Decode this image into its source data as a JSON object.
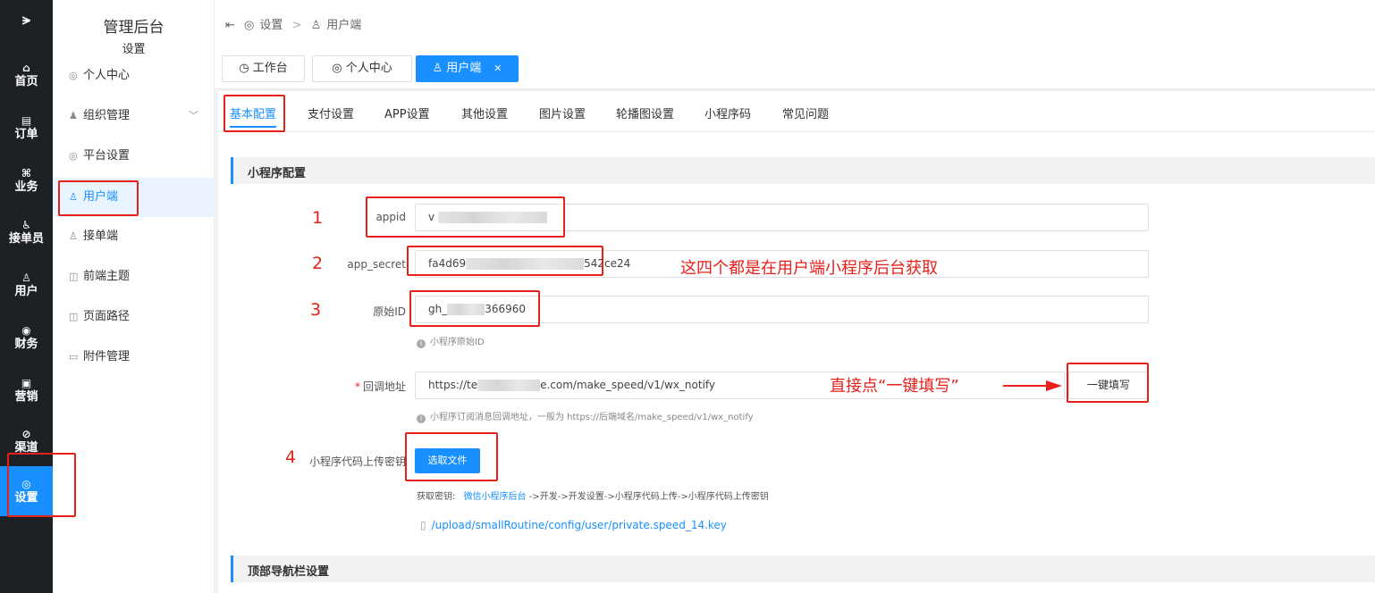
{
  "rail": {
    "logo": "⪫",
    "items": [
      {
        "label": "首页",
        "icon": "home-icon",
        "glyph": "⌂"
      },
      {
        "label": "订单",
        "icon": "order-icon",
        "glyph": "▤"
      },
      {
        "label": "业务",
        "icon": "business-icon",
        "glyph": "⌘"
      },
      {
        "label": "接单员",
        "icon": "rider-icon",
        "glyph": "♿"
      },
      {
        "label": "用户",
        "icon": "user-icon",
        "glyph": "♙"
      },
      {
        "label": "财务",
        "icon": "finance-icon",
        "glyph": "◉"
      },
      {
        "label": "营销",
        "icon": "marketing-icon",
        "glyph": "▣"
      },
      {
        "label": "渠道",
        "icon": "channel-icon",
        "glyph": "⊘"
      },
      {
        "label": "设置",
        "icon": "settings-icon",
        "glyph": "◎"
      }
    ],
    "active_color": "#1890ff"
  },
  "submenu": {
    "title": "管理后台",
    "subtitle": "设置",
    "items": [
      {
        "label": "个人中心",
        "icon": "profile-icon",
        "glyph": "◎"
      },
      {
        "label": "组织管理",
        "icon": "org-icon",
        "glyph": "♟"
      },
      {
        "label": "平台设置",
        "icon": "platform-icon",
        "glyph": "◎"
      },
      {
        "label": "用户端",
        "icon": "user-client-icon",
        "glyph": "♙"
      },
      {
        "label": "接单端",
        "icon": "worker-client-icon",
        "glyph": "♙"
      },
      {
        "label": "前端主题",
        "icon": "theme-icon",
        "glyph": "◫"
      },
      {
        "label": "页面路径",
        "icon": "page-path-icon",
        "glyph": "◫"
      },
      {
        "label": "附件管理",
        "icon": "attachment-icon",
        "glyph": "▭"
      }
    ]
  },
  "breadcrumb": {
    "collapse_glyph": "⇤",
    "root": "设置",
    "sep": ">",
    "current": "用户端"
  },
  "page_tabs": [
    {
      "label": "工作台",
      "glyph": "◷"
    },
    {
      "label": "个人中心",
      "glyph": "◎"
    },
    {
      "label": "用户端",
      "glyph": "♙",
      "close": "✕"
    }
  ],
  "settings_tabs": [
    "基本配置",
    "支付设置",
    "APP设置",
    "其他设置",
    "图片设置",
    "轮播图设置",
    "小程序码",
    "常见问题"
  ],
  "section_mini": "小程序配置",
  "form": {
    "appid": {
      "label": "appid",
      "value_visible": "v"
    },
    "app_secret": {
      "label": "app_secret",
      "prefix": "fa4d69",
      "suffix": "542ce24"
    },
    "origin_id": {
      "label": "原始ID",
      "prefix": "gh_",
      "suffix": "366960",
      "hint": "小程序原始ID"
    },
    "callback": {
      "required_mark": "*",
      "label": "回调地址",
      "prefix": "https://te",
      "suffix": "e.com/make_speed/v1/wx_notify",
      "hint": "小程序订阅消息回调地址，一般为 https://后端域名/make_speed/v1/wx_notify",
      "fill_button": "一键填写"
    },
    "upload_key": {
      "label": "小程序代码上传密钥",
      "button": "选取文件",
      "fetch_label": "获取密钥:",
      "fetch_link": "微信小程序后台",
      "fetch_path": "->开发->开发设置->小程序代码上传->小程序代码上传密钥",
      "file_path": "/upload/smallRoutine/config/user/private.speed_14.key",
      "file_icon": "file-icon"
    }
  },
  "section_nav": "顶部导航栏设置",
  "annotations": {
    "num1": "1",
    "num2": "2",
    "num3": "3",
    "num4": "4",
    "note_four": "这四个都是在用户端小程序后台获取",
    "note_fill": "直接点“一键填写”",
    "color": "#e8201a"
  }
}
